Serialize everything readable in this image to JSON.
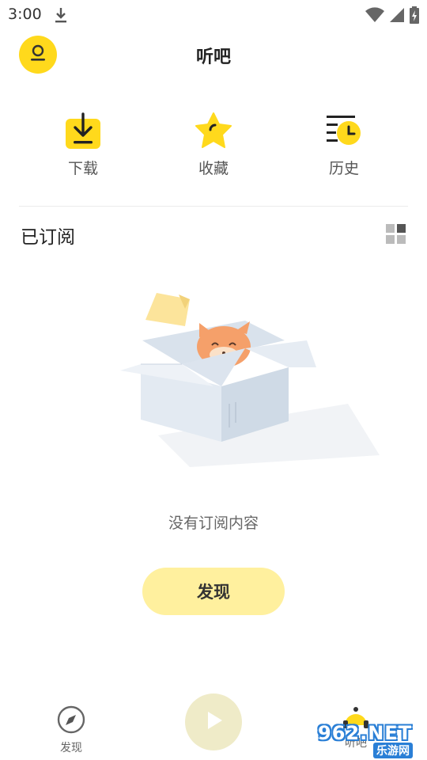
{
  "status_bar": {
    "time": "3:00",
    "icons": [
      "download-icon",
      "wifi-icon",
      "signal-icon",
      "battery-charging-icon"
    ]
  },
  "header": {
    "title": "听吧",
    "avatar_icon": "user-icon"
  },
  "quick_actions": [
    {
      "label": "下载",
      "icon": "download-box-icon"
    },
    {
      "label": "收藏",
      "icon": "star-icon"
    },
    {
      "label": "历史",
      "icon": "history-clock-icon"
    }
  ],
  "subscriptions": {
    "title": "已订阅",
    "view_toggle_icon": "grid-view-icon",
    "empty_text": "没有订阅内容",
    "discover_button": "发现"
  },
  "bottom_nav": {
    "discover_label": "发现",
    "discover_icon": "compass-icon",
    "play_icon": "play-icon",
    "tingba_label": "听吧",
    "tingba_icon": "headphone-mascot-icon"
  },
  "watermark": {
    "top": "962.NET",
    "bottom": "乐游网"
  },
  "colors": {
    "accent": "#FFD91C",
    "discover_button_bg": "#FFF09E",
    "play_button_bg": "#EFEBC8"
  }
}
